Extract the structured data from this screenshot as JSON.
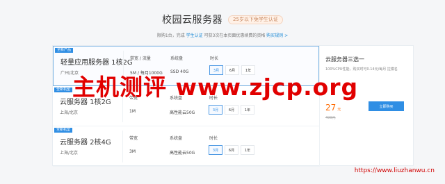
{
  "header": {
    "title": "校园云服务器",
    "age_badge": "25岁以下免学生认证",
    "subtitle_prefix": "限购1台，完成",
    "subtitle_link_1": "学生认证",
    "subtitle_middle": "可获3次在本页面优惠续费的资格",
    "subtitle_link_2": "购买规则 >"
  },
  "columns": {
    "bandwidth": "带宽 / 流量",
    "bandwidth_short": "带宽",
    "disk": "系统盘",
    "duration": "时长"
  },
  "products": [
    {
      "tag": "全新产品",
      "name": "轻量应用服务器 1核2G",
      "region": "广州/北京",
      "bandwidth": "5M / 每月1000G",
      "disk": "SSD 40G",
      "options": [
        "3月",
        "6月",
        "1年"
      ]
    },
    {
      "tag": "全新机型",
      "name": "云服务器 1核2G",
      "region": "上海/北京",
      "bandwidth": "1M",
      "disk": "高性能云50G",
      "options": [
        "3月",
        "6月",
        "1年"
      ]
    },
    {
      "tag": "全新机型",
      "name": "云服务器 2核4G",
      "region": "上海/北京",
      "bandwidth": "3M",
      "disk": "高性能云50G",
      "options": [
        "3月",
        "6月",
        "1年"
      ]
    }
  ],
  "summary": {
    "title": "云服务器三选一",
    "description": "100%CPU性能，购买时可0.14元/每月 拉模名",
    "price": "27",
    "price_unit": "元",
    "old_price": "499元",
    "buy_label": "立即购买"
  },
  "watermarks": {
    "main": "主机测评 www.zjcp.org",
    "url": "https://www.liuzhanwu.cn"
  }
}
